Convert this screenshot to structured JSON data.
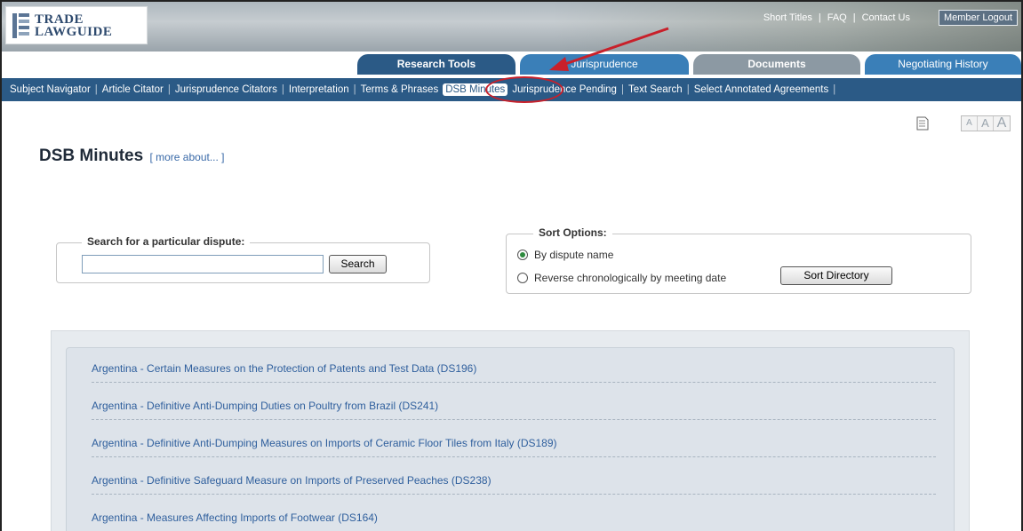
{
  "header": {
    "logo_line1": "TRADE",
    "logo_line2": "LAWGUIDE",
    "top_links": [
      "Short Titles",
      "FAQ",
      "Contact Us"
    ],
    "logout_label": "Member Logout"
  },
  "tabs": [
    {
      "label": "Research Tools",
      "active": true
    },
    {
      "label": "Jurisprudence",
      "active": false
    },
    {
      "label": "Documents",
      "active": false
    },
    {
      "label": "Negotiating History",
      "active": false
    }
  ],
  "subnav": [
    {
      "label": "Subject Navigator"
    },
    {
      "label": "Article Citator"
    },
    {
      "label": "Jurisprudence Citators"
    },
    {
      "label": "Interpretation"
    },
    {
      "label": "Terms & Phrases"
    },
    {
      "label": "DSB Minutes",
      "active": true
    },
    {
      "label": "Jurisprudence Pending"
    },
    {
      "label": "Text Search"
    },
    {
      "label": "Select Annotated Agreements"
    }
  ],
  "page": {
    "title": "DSB Minutes",
    "more_about": "[ more about... ]"
  },
  "font_sizes": [
    "A",
    "A",
    "A"
  ],
  "search": {
    "legend": "Search for a particular dispute:",
    "value": "",
    "button_label": "Search"
  },
  "sort": {
    "legend": "Sort Options:",
    "option1": "By dispute name",
    "option2": "Reverse chronologically by meeting date",
    "selected": "option1",
    "button_label": "Sort Directory"
  },
  "disputes": [
    "Argentina - Certain Measures on the Protection of Patents and Test Data (DS196)",
    "Argentina - Definitive Anti-Dumping Duties on Poultry from Brazil (DS241)",
    "Argentina - Definitive Anti-Dumping Measures on Imports of Ceramic Floor Tiles from Italy (DS189)",
    "Argentina - Definitive Safeguard Measure on Imports of Preserved Peaches (DS238)",
    "Argentina - Measures Affecting Imports of Footwear (DS164)"
  ],
  "colors": {
    "nav_blue": "#2b5a86",
    "link_blue": "#2f5f9d",
    "annotation_red": "#c8202a"
  }
}
